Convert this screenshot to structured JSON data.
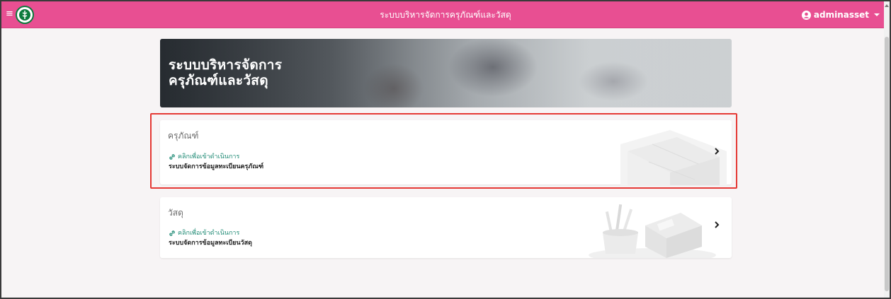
{
  "navbar": {
    "menu_icon": "hamburger-icon",
    "logo_icon": "ministry-logo-icon",
    "title": "ระบบบริหารจัดการครุภัณฑ์และวัสดุ",
    "user": {
      "icon": "user-circle-icon",
      "name": "adminasset"
    },
    "color": "#e84f92"
  },
  "banner": {
    "title_line1": "ระบบบริหารจัดการ",
    "title_line2": "ครุภัณฑ์และวัสดุ"
  },
  "cards": [
    {
      "title": "ครุภัณฑ์",
      "link_icon": "link-icon",
      "link_text": "คลิกเพื่อเข้าดำเนินการ",
      "description": "ระบบจัดการข้อมูลทะเบียนครุภัณฑ์",
      "chevron": "chevron-right-icon",
      "illustration": "boxes-illustration",
      "highlighted": true
    },
    {
      "title": "วัสดุ",
      "link_icon": "link-icon",
      "link_text": "คลิกเพื่อเข้าดำเนินการ",
      "description": "ระบบจัดการข้อมูลทะเบียนวัสดุ",
      "chevron": "chevron-right-icon",
      "illustration": "stationery-illustration",
      "highlighted": false
    }
  ],
  "colors": {
    "accent": "#e84f92",
    "link": "#1e8a74",
    "highlight": "#e53935"
  }
}
